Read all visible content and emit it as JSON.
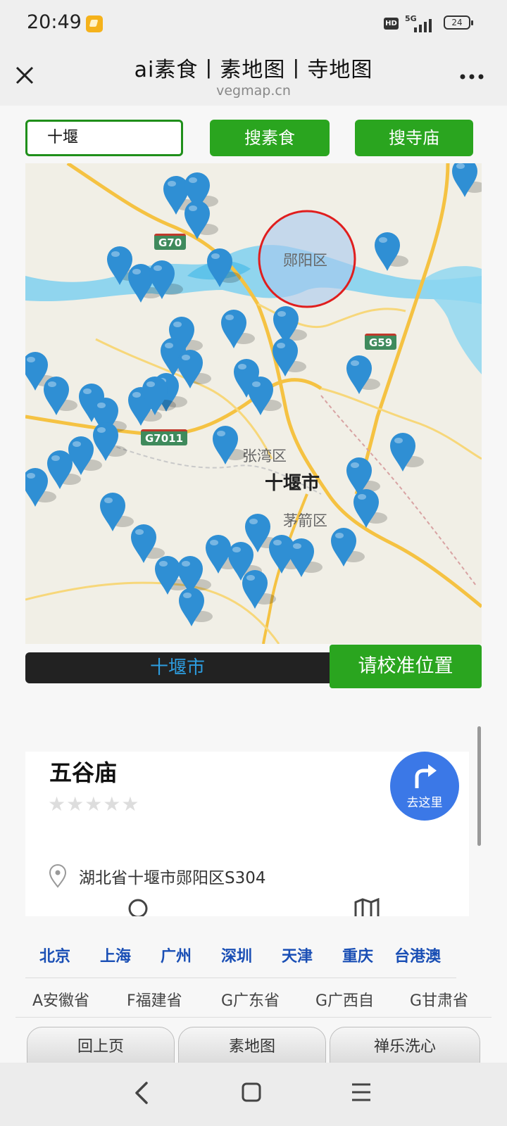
{
  "status_bar": {
    "time": "20:49",
    "hd": "HD",
    "network": "5G",
    "battery": "24"
  },
  "title_bar": {
    "title": "ai素食丨素地图丨寺地图",
    "domain": "vegmap.cn"
  },
  "search": {
    "value": "十堰",
    "food_button": "搜素食",
    "temple_button": "搜寺庙"
  },
  "map": {
    "district_labels": [
      "郧阳区",
      "张湾区",
      "茅箭区"
    ],
    "city_label": "十堰市",
    "road_shields": [
      "G70",
      "G59",
      "G7011"
    ]
  },
  "city_bar": {
    "current_city": "十堰市",
    "calibrate_button": "请校准位置"
  },
  "detail": {
    "name": "五谷庙",
    "rating": 0,
    "rating_max": 5,
    "stars": "★★★★★",
    "go_here": "去这里",
    "address": "湖北省十堰市郧阳区S304"
  },
  "cities": [
    "北京",
    "上海",
    "广州",
    "深圳",
    "天津",
    "重庆",
    "台港澳"
  ],
  "provinces": [
    "A安徽省",
    "F福建省",
    "G广东省",
    "G广西自",
    "G甘肃省"
  ],
  "bottom_tabs": [
    "回上页",
    "素地图",
    "禅乐洗心"
  ],
  "colors": {
    "accent_green": "#2aa51f",
    "marker_blue": "#2f8fd4",
    "go_button_blue": "#3b78e7",
    "link_blue": "#1a4fb5"
  }
}
